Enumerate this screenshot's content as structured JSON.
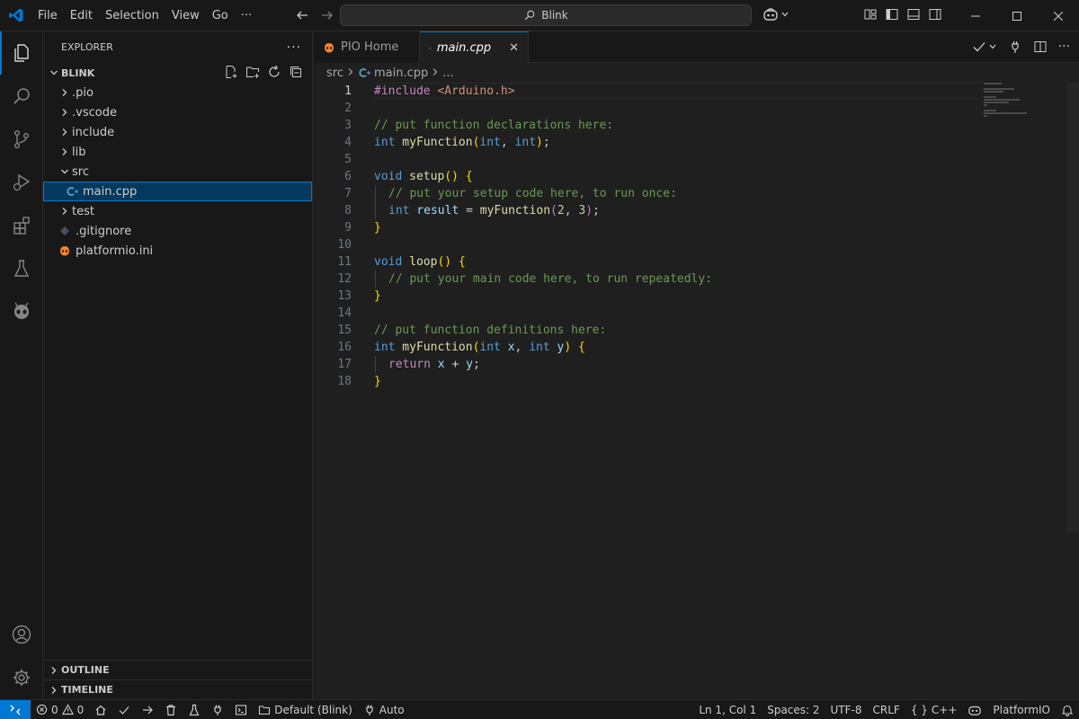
{
  "menu": [
    "File",
    "Edit",
    "Selection",
    "View",
    "Go",
    "···"
  ],
  "search": {
    "label": "Blink"
  },
  "sidebar": {
    "title": "EXPLORER",
    "more": "···",
    "project": "BLINK",
    "tree": [
      {
        "label": ".pio",
        "type": "folder",
        "expanded": false,
        "depth": 0
      },
      {
        "label": ".vscode",
        "type": "folder",
        "expanded": false,
        "depth": 0
      },
      {
        "label": "include",
        "type": "folder",
        "expanded": false,
        "depth": 0
      },
      {
        "label": "lib",
        "type": "folder",
        "expanded": false,
        "depth": 0
      },
      {
        "label": "src",
        "type": "folder",
        "expanded": true,
        "depth": 0
      },
      {
        "label": "main.cpp",
        "type": "cpp",
        "depth": 1,
        "selected": true
      },
      {
        "label": "test",
        "type": "folder",
        "expanded": false,
        "depth": 0
      },
      {
        "label": ".gitignore",
        "type": "gitignore",
        "depth": 0
      },
      {
        "label": "platformio.ini",
        "type": "pio",
        "depth": 0
      }
    ],
    "outline": "OUTLINE",
    "timeline": "TIMELINE"
  },
  "tabs": [
    {
      "label": "PIO Home",
      "active": false
    },
    {
      "label": "main.cpp",
      "active": true,
      "close": "✕"
    }
  ],
  "breadcrumb": {
    "folder": "src",
    "file": "main.cpp",
    "more": "..."
  },
  "code": {
    "line_numbers": [
      "1",
      "2",
      "3",
      "4",
      "5",
      "6",
      "7",
      "8",
      "9",
      "10",
      "11",
      "12",
      "13",
      "14",
      "15",
      "16",
      "17",
      "18"
    ],
    "l1_a": "#include ",
    "l1_b": "<Arduino.h>",
    "l3": "// put function declarations here:",
    "l4_a": "int",
    "l4_b": " myFunction",
    "l4_c": "(",
    "l4_d": "int",
    "l4_e": ", ",
    "l4_f": "int",
    "l4_g": ")",
    "l4_h": ";",
    "l6_a": "void",
    "l6_b": " setup",
    "l6_c": "()",
    "l6_d": " {",
    "l7": "// put your setup code here, to run once:",
    "l8_a": "int",
    "l8_b": " result",
    "l8_c": " = ",
    "l8_d": "myFunction",
    "l8_e": "(",
    "l8_f": "2",
    "l8_g": ", ",
    "l8_h": "3",
    "l8_i": ")",
    "l8_j": ";",
    "l9": "}",
    "l11_a": "void",
    "l11_b": " loop",
    "l11_c": "()",
    "l11_d": " {",
    "l12": "// put your main code here, to run repeatedly:",
    "l13": "}",
    "l15": "// put function definitions here:",
    "l16_a": "int",
    "l16_b": " myFunction",
    "l16_c": "(",
    "l16_d": "int",
    "l16_e": " x",
    "l16_f": ", ",
    "l16_g": "int",
    "l16_h": " y",
    "l16_i": ")",
    "l16_j": " {",
    "l17_a": "return",
    "l17_b": " x",
    "l17_c": " + ",
    "l17_d": "y",
    "l17_e": ";",
    "l18": "}"
  },
  "status": {
    "errors": "0",
    "warnings": "0",
    "env": "Default (Blink)",
    "auto": "Auto",
    "position": "Ln 1, Col 1",
    "spaces": "Spaces: 2",
    "encoding": "UTF-8",
    "eol": "CRLF",
    "language": "C++",
    "platformio": "PlatformIO"
  },
  "colors": {
    "accent": "#0078d4",
    "keyword": "#569cd6",
    "comment": "#6a9955",
    "string": "#ce9178",
    "function": "#dcdcaa",
    "variable": "#9cdcfe",
    "number": "#b5cea8",
    "bracket": "#ffd700"
  }
}
